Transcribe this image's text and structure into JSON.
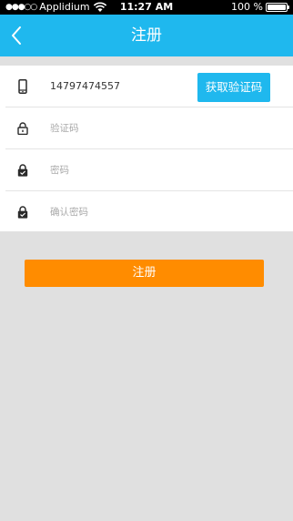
{
  "status_bar": {
    "signal": "●●●○○",
    "carrier": "Applidium",
    "time": "11:27 AM",
    "battery": "100 %"
  },
  "nav": {
    "back_icon": "chevron-left-icon",
    "title": "注册"
  },
  "form": {
    "phone": {
      "icon": "phone-icon",
      "value": "14797474557"
    },
    "get_code_button": "获取验证码",
    "code": {
      "icon": "lock-open-icon",
      "placeholder": "验证码"
    },
    "password": {
      "icon": "lock-icon",
      "placeholder": "密码"
    },
    "confirm_password": {
      "icon": "lock-icon",
      "placeholder": "确认密码"
    }
  },
  "submit_button": "注册",
  "colors": {
    "nav_bg": "#1fb8ee",
    "code_button_bg": "#1fb8ee",
    "submit_bg": "#ff8c00",
    "page_bg": "#e0e0e0"
  }
}
